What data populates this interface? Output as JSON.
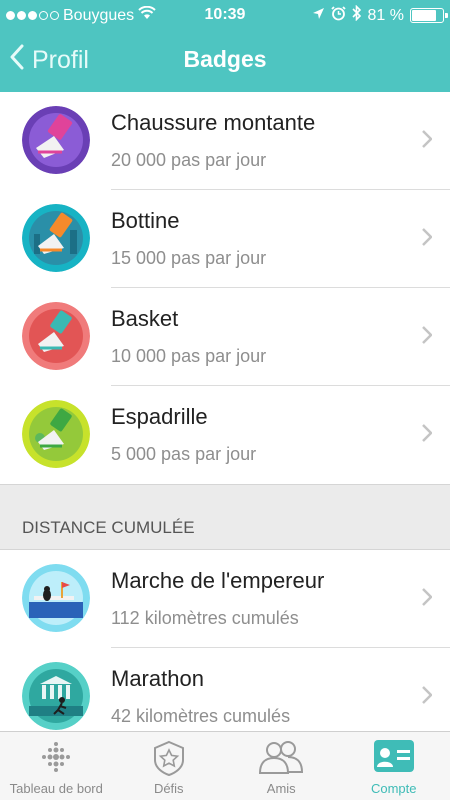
{
  "status": {
    "carrier": "Bouygues",
    "time": "10:39",
    "battery": "81 %",
    "battery_level": 0.81
  },
  "nav": {
    "back_label": "Profil",
    "title": "Badges"
  },
  "daily_badges": [
    {
      "title": "Chaussure montante",
      "subtitle": "20 000 pas par jour"
    },
    {
      "title": "Bottine",
      "subtitle": "15 000 pas par jour"
    },
    {
      "title": "Basket",
      "subtitle": "10 000 pas par jour"
    },
    {
      "title": "Espadrille",
      "subtitle": "5 000 pas par jour"
    }
  ],
  "distance_section": {
    "header": "DISTANCE CUMULÉE",
    "badges": [
      {
        "title": "Marche de l'empereur",
        "subtitle": "112 kilomètres cumulés"
      },
      {
        "title": "Marathon",
        "subtitle": "42 kilomètres cumulés"
      }
    ]
  },
  "tabs": [
    {
      "label": "Tableau de bord",
      "icon": "dashboard-dots-icon"
    },
    {
      "label": "Défis",
      "icon": "badge-star-icon"
    },
    {
      "label": "Amis",
      "icon": "friends-icon"
    },
    {
      "label": "Compte",
      "icon": "account-card-icon",
      "active": true
    }
  ],
  "colors": {
    "accent": "#4ec5c1",
    "active_tab": "#3fbcb7"
  }
}
